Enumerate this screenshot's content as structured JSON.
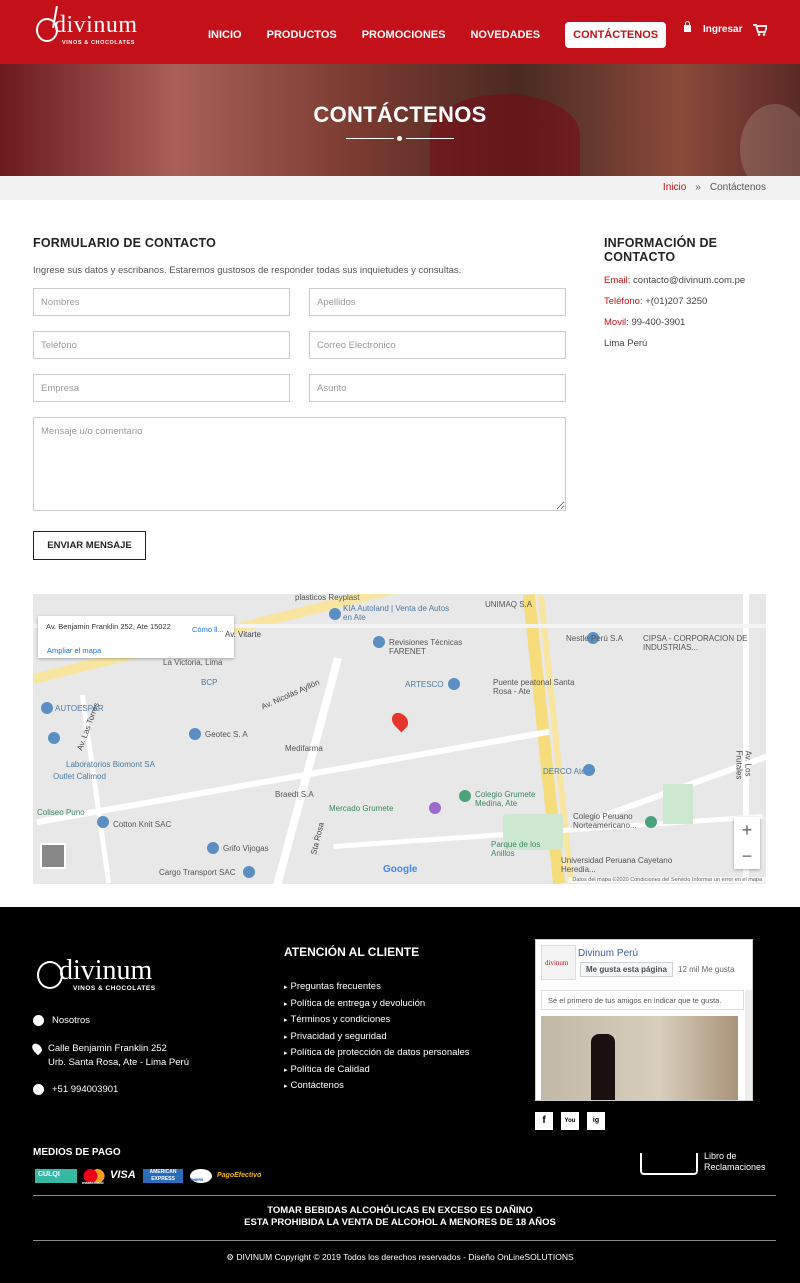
{
  "header": {
    "logo_word": "divinum",
    "logo_sub": "VINOS & CHOCOLATES",
    "nav": [
      "INICIO",
      "PRODUCTOS",
      "PROMOCIONES",
      "NOVEDADES",
      "CONTÁCTENOS"
    ],
    "login_label": "Ingresar"
  },
  "hero": {
    "title": "CONTÁCTENOS"
  },
  "breadcrumb": {
    "home": "Inicio",
    "sep": "»",
    "current": "Contáctenos"
  },
  "form": {
    "title": "FORMULARIO DE CONTACTO",
    "intro": "Ingrese sus datos y escribanos. Estaremos gustosos de responder todas sus inquietudes y consultas.",
    "nombres": "Nombres",
    "apellidos": "Apellidos",
    "telefono": "Teléfono",
    "correo": "Correo Electronico",
    "empresa": "Empresa",
    "asunto": "Asunto",
    "mensaje": "Mensaje u/o comentario",
    "submit": "ENVIAR MENSAJE"
  },
  "info": {
    "title": "INFORMACIÓN DE CONTACTO",
    "email_label": "Email:",
    "email": "contacto@divinum.com.pe",
    "tel_label": "Teléfono:",
    "tel": "+(01)207 3250",
    "movil_label": "Movil:",
    "movil": "99-400-3901",
    "location": "Lima Perú"
  },
  "map": {
    "card_address": "Av. Benjamin Franklin 252, Ate 15022",
    "card_como": "Cómo ll...",
    "card_ampliar": "Ampliar el mapa",
    "marker_label": "Avenida Benjamin Franklin 252",
    "labels": {
      "reyplast": "plasticos Reyplast",
      "kia": "KIA Autoland | Venta de Autos en Ate",
      "unimaq": "UNIMAQ S.A",
      "vitarte": "Av. Vitarte",
      "revisiones": "Revisiones Técnicas FARENET",
      "victoria": "La Victoria, Lima",
      "nestle": "Nestle Perú S.A",
      "cipsa": "CIPSA - CORPORACION DE INDUSTRIAS...",
      "bcp": "BCP",
      "autoespar": "AUTOESPAR",
      "artesco": "ARTESCO",
      "puente": "Puente peatonal Santa Rosa - Ate",
      "geotec": "Geotec S. A",
      "medifarma": "Medifarma",
      "biomont": "Laboratorios Biomont SA",
      "calimod": "Outlet Calimod",
      "derco": "DERCO Ate",
      "braedt": "Braedt S.A",
      "grumete_col": "Colegio Grumete Medina, Ate",
      "coliseo": "Coliseo Puno",
      "cotton": "Cotton Knit SAC",
      "mercado": "Mercado Grumete",
      "colegio_peruano": "Colegio Peruano Norteamericano...",
      "grifo": "Grifo Vijogas",
      "parque": "Parque de los Anillos",
      "universidad": "Universidad Peruana Cayetano Heredia...",
      "cargo": "Cargo Transport SAC",
      "nicolas": "Av. Nicolás Ayllón",
      "torres": "Av. Las Torres",
      "frutales": "Av. Los Frutales",
      "sta_rosa": "Sta Rosa"
    },
    "google": "Google",
    "footer_text": "Datos del mapa ©2020   Condiciones del Servicio   Informar un error en el mapa"
  },
  "footer": {
    "logo_word": "divinum",
    "logo_sub": "VINOS & CHOCOLATES",
    "nosotros": "Nosotros",
    "address1": "Calle Benjamin Franklin 252",
    "address2": "Urb. Santa Rosa, Ate - Lima Perú",
    "phone": "+51 994003901",
    "atencion_title": "ATENCIÓN AL CLIENTE",
    "links": [
      "Preguntas frecuentes",
      "Política de entrega y devolución",
      "Términos y condiciones",
      "Privacidad y seguridad",
      "Política de protección de datos personales",
      "Política de Calidad",
      "Contáctenos"
    ],
    "fb_name": "Divinum Perú",
    "fb_like": "Me gusta esta página",
    "fb_count": "12 mil Me gusta",
    "fb_first": "Sé el primero de tus amigos en indicar que te gusta.",
    "social": [
      "f",
      "You",
      "ig"
    ],
    "pago_title": "MEDIOS DE PAGO",
    "pagos": [
      "CULQI",
      "mastercard",
      "VISA",
      "AMERICAN EXPRESS",
      "DINERS",
      "PagoEfectivo"
    ],
    "libro": "Libro de Reclamaciones",
    "warn1": "TOMAR BEBIDAS ALCOHÓLICAS EN EXCESO ES DAÑINO",
    "warn2": "ESTA PROHIBIDA LA VENTA DE ALCOHOL A MENORES DE 18 AÑOS",
    "copyright": "DIVINUM Copyright © 2019 Todos los derechos reservados - Diseño OnLineSOLUTIONS"
  },
  "colors": {
    "brand": "#c41018",
    "footer_bg": "#000000"
  }
}
